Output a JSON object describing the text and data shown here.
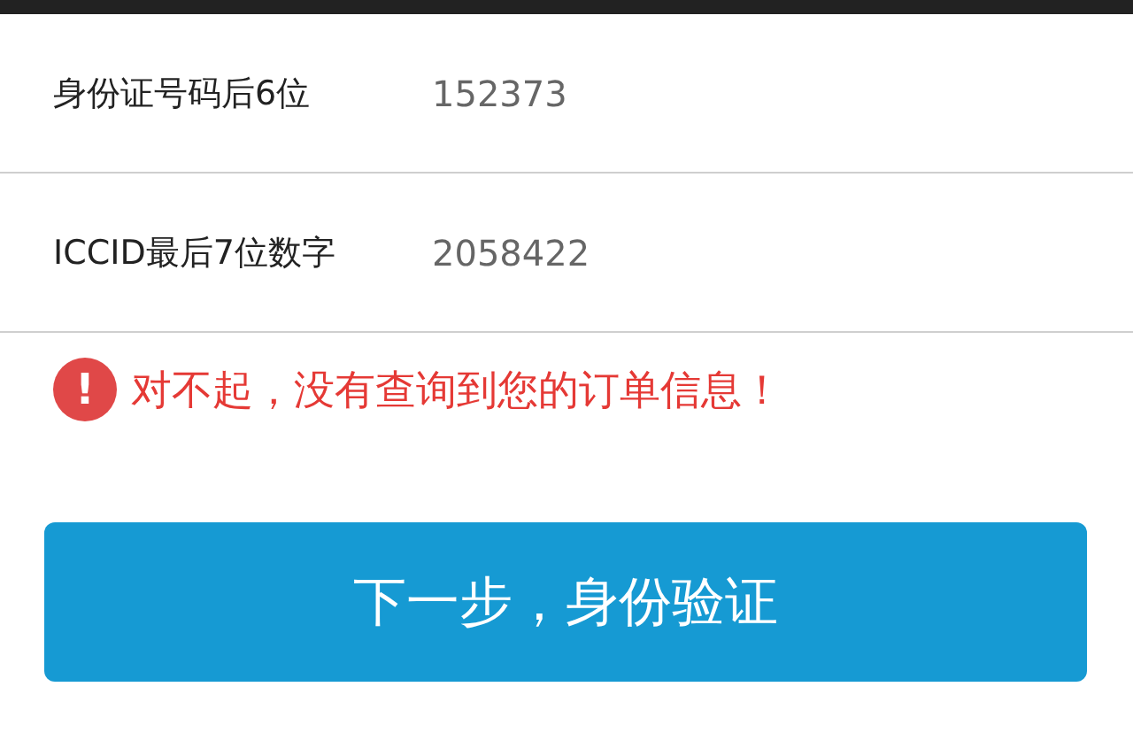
{
  "fields": [
    {
      "label": "身份证号码后6位",
      "value": "152373"
    },
    {
      "label": "ICCID最后7位数字",
      "value": "2058422"
    }
  ],
  "error": {
    "icon": "!",
    "message": "对不起，没有查询到您的订单信息！"
  },
  "submit_button": "下一步，身份验证"
}
